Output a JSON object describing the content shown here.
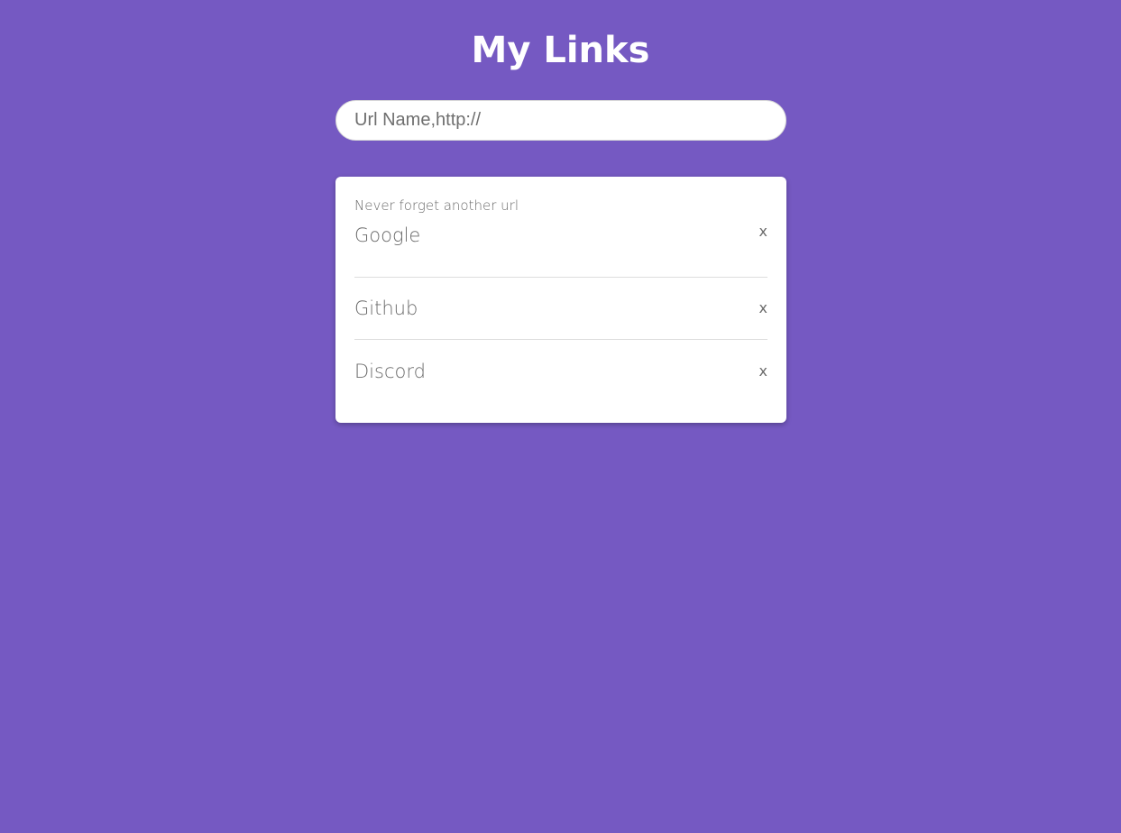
{
  "header": {
    "title": "My Links"
  },
  "input": {
    "placeholder": "Url Name,http://",
    "value": ""
  },
  "card": {
    "subtitle": "Never forget another url",
    "links": [
      {
        "name": "Google",
        "remove_label": "x"
      },
      {
        "name": "Github",
        "remove_label": "x"
      },
      {
        "name": "Discord",
        "remove_label": "x"
      }
    ]
  },
  "colors": {
    "background": "#7559c2",
    "card": "#ffffff",
    "title": "#ffffff",
    "link_text": "#6b6b6b"
  }
}
